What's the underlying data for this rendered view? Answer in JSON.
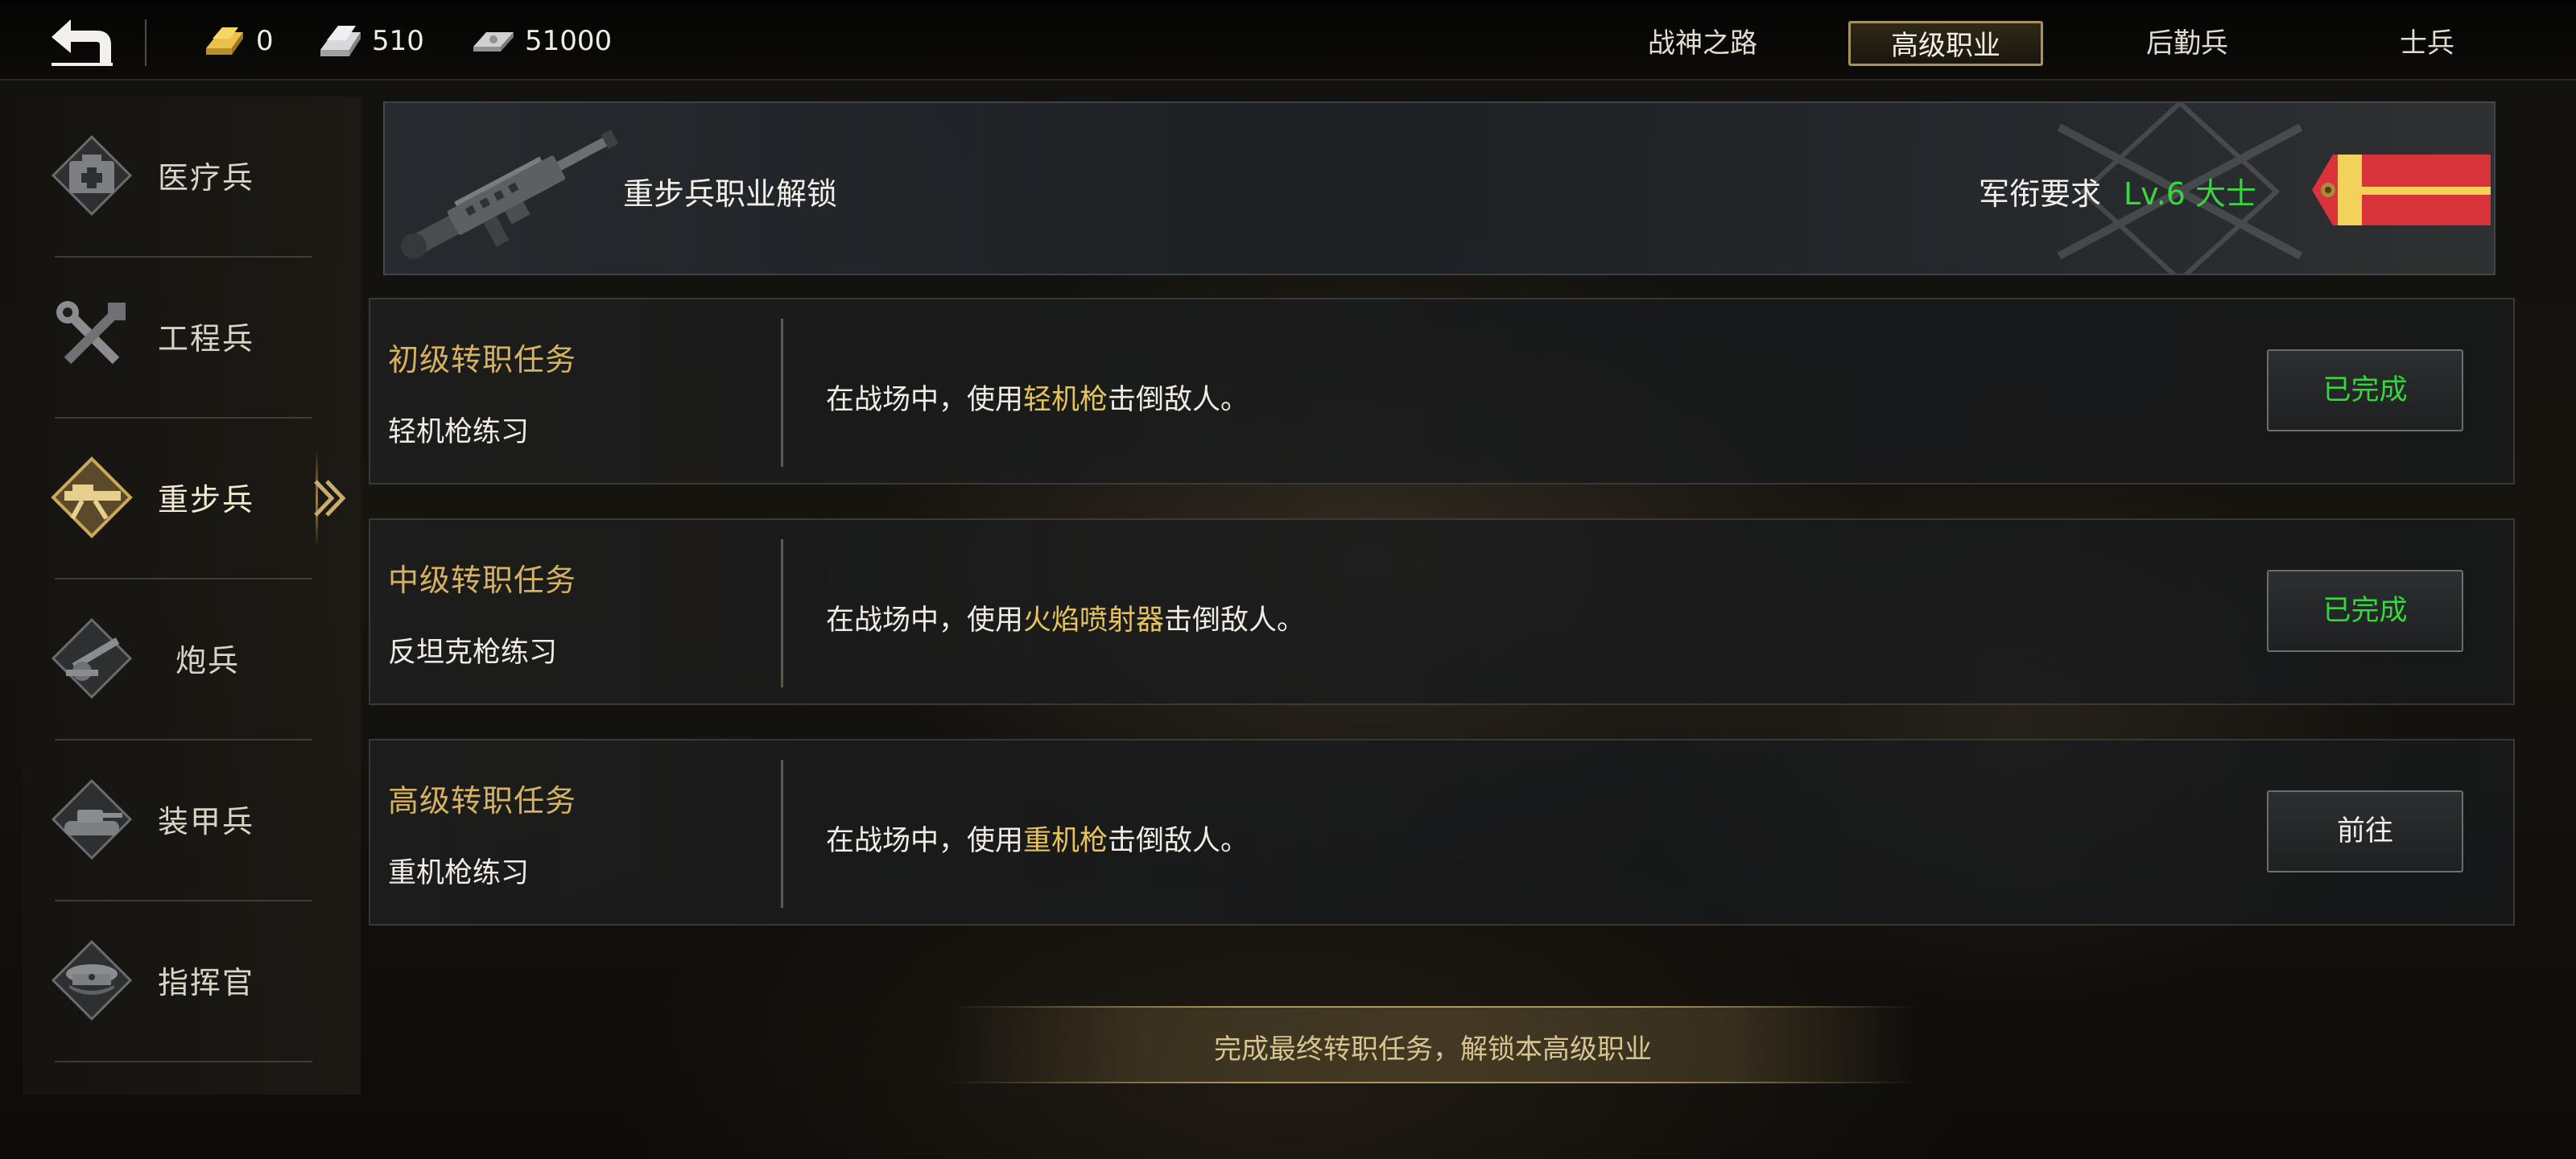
{
  "currencies": [
    {
      "icon": "gold-bar-icon",
      "value": "0"
    },
    {
      "icon": "silver-bar-icon",
      "value": "510"
    },
    {
      "icon": "cash-icon",
      "value": "51000"
    }
  ],
  "top_tabs": [
    {
      "label": "战神之路",
      "active": false
    },
    {
      "label": "高级职业",
      "active": true
    },
    {
      "label": "后勤兵",
      "active": false
    },
    {
      "label": "士兵",
      "active": false
    }
  ],
  "sidebar": {
    "items": [
      {
        "label": "医疗兵",
        "icon": "medic-kit-icon",
        "active": false
      },
      {
        "label": "工程兵",
        "icon": "wrench-icon",
        "active": false
      },
      {
        "label": "重步兵",
        "icon": "heavy-gun-icon",
        "active": true
      },
      {
        "label": "炮兵",
        "icon": "artillery-icon",
        "active": false
      },
      {
        "label": "装甲兵",
        "icon": "tank-icon",
        "active": false
      },
      {
        "label": "指挥官",
        "icon": "officer-cap-icon",
        "active": false
      }
    ]
  },
  "banner": {
    "title": "重步兵职业解锁",
    "requirement_label": "军衔要求",
    "requirement_value": "Lv.6 大士",
    "weapon_icon": "machine-gun-icon",
    "badge_icon": "rank-epaulette-icon",
    "colors": {
      "requirement": "#39d640",
      "badge_red": "#d8323a",
      "badge_gold": "#f2d25a"
    }
  },
  "tasks": [
    {
      "tier": "初级转职任务",
      "practice": "轻机枪练习",
      "desc_pre": "在战场中，使用",
      "desc_hl": "轻机枪",
      "desc_post": "击倒敌人。",
      "status": "已完成",
      "done": true
    },
    {
      "tier": "中级转职任务",
      "practice": "反坦克枪练习",
      "desc_pre": "在战场中，使用",
      "desc_hl": "火焰喷射器",
      "desc_post": "击倒敌人。",
      "status": "已完成",
      "done": true
    },
    {
      "tier": "高级转职任务",
      "practice": "重机枪练习",
      "desc_pre": "在战场中，使用",
      "desc_hl": "重机枪",
      "desc_post": "击倒敌人。",
      "status": "前往",
      "done": false
    }
  ],
  "notice": "完成最终转职任务，解锁本高级职业",
  "colors": {
    "tier_gold": "#d7b25e",
    "highlight": "#e6c45a",
    "done_green": "#37d63c",
    "accent_gold": "#a8915a"
  }
}
